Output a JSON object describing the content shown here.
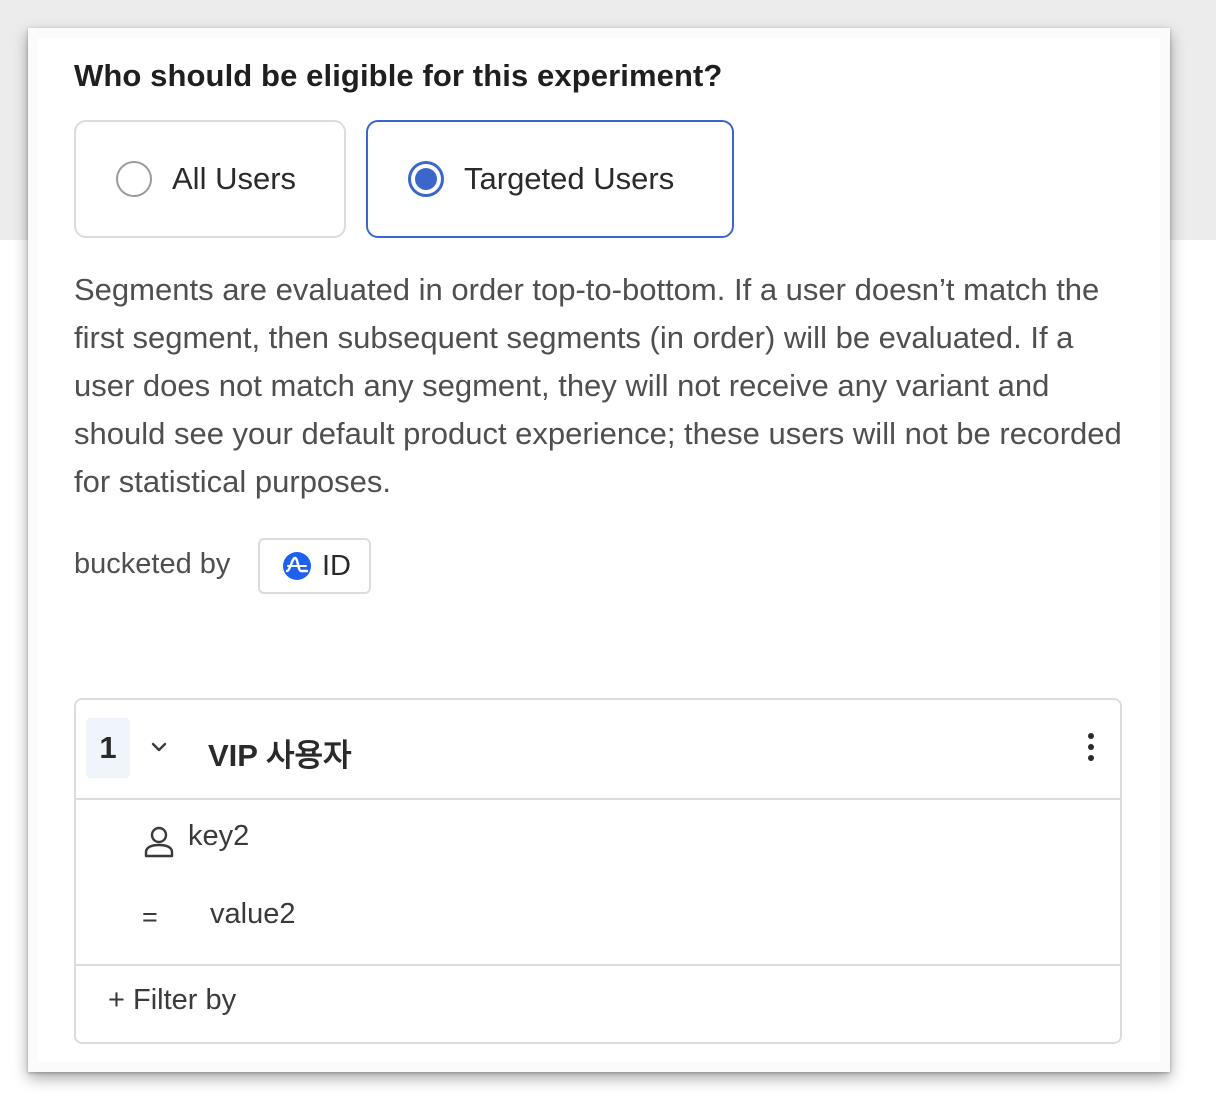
{
  "eligibility": {
    "question": "Who should be eligible for this experiment?",
    "options": [
      {
        "label": "All Users",
        "selected": false
      },
      {
        "label": "Targeted Users",
        "selected": true
      }
    ],
    "description": "Segments are evaluated in order top-to-bottom. If a user doesn’t match the first segment, then subsequent segments (in order) will be evaluated. If a user does not match any segment, they will not receive any variant and should see your default product experience; these users will not be recorded for statistical purposes."
  },
  "bucketing": {
    "label": "bucketed by",
    "value": "ID",
    "icon": "amplitude-logo-icon"
  },
  "segment": {
    "number": "1",
    "name": "VIP 사용자",
    "condition": {
      "property": "key2",
      "operator": "=",
      "value": "value2"
    },
    "filter_by_label": "+ Filter by"
  },
  "colors": {
    "accent": "#3a67c9",
    "border": "#dcdcdc",
    "text": "#2a2a2a",
    "muted_text": "#4f4f4f"
  }
}
